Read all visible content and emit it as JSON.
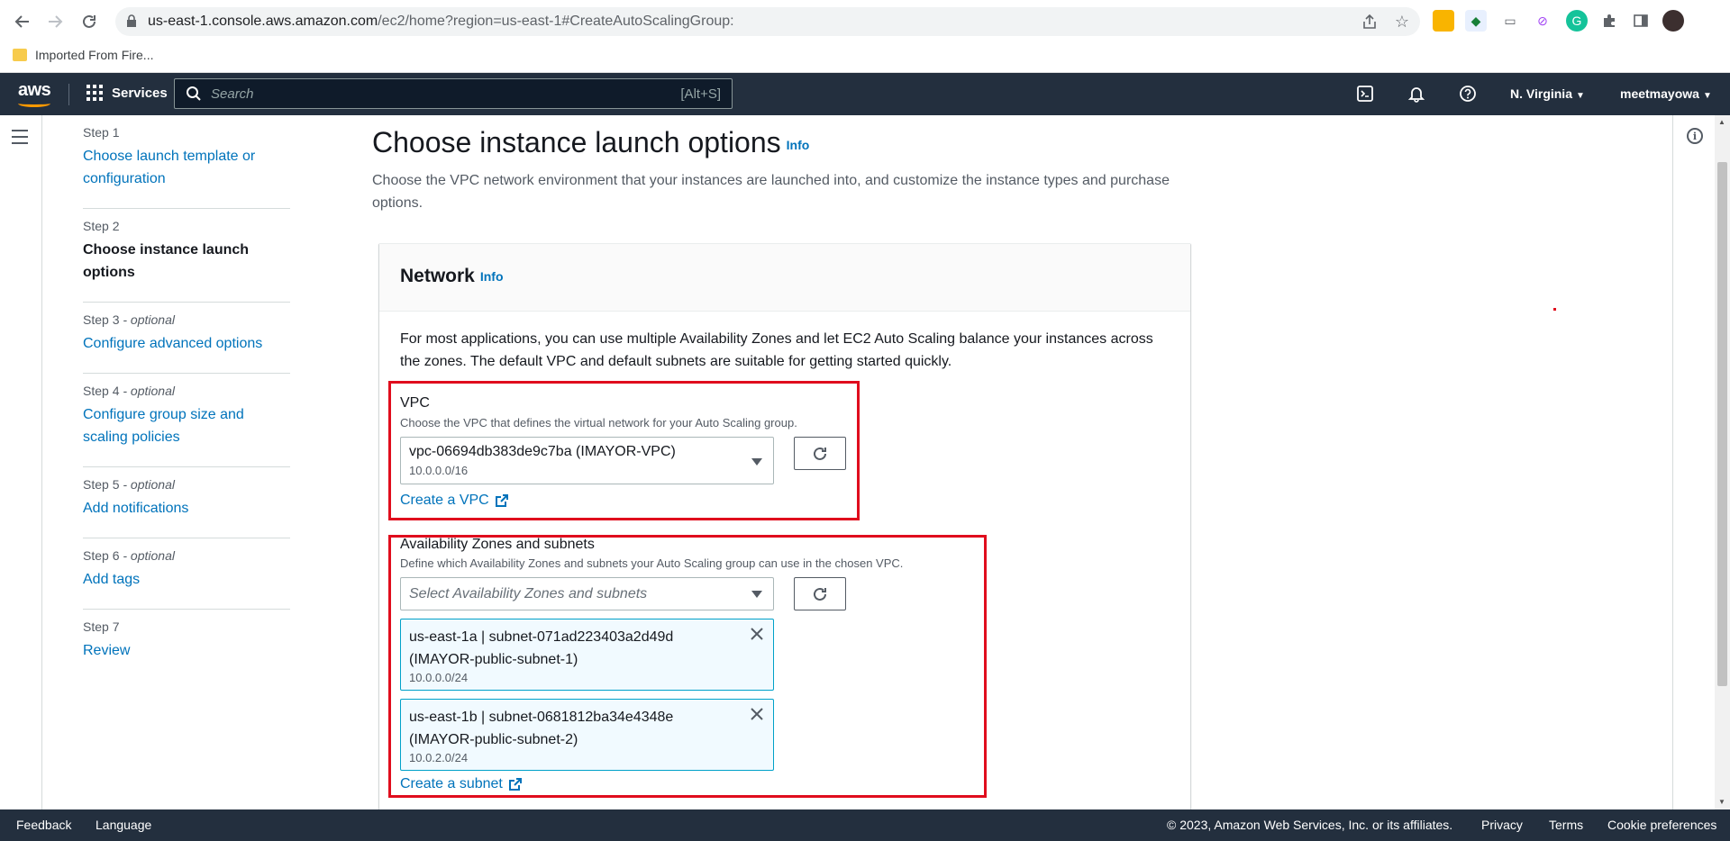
{
  "browser": {
    "url_host": "us-east-1.console.aws.amazon.com",
    "url_path": "/ec2/home?region=us-east-1#CreateAutoScalingGroup:",
    "bookmark_label": "Imported From Fire..."
  },
  "header": {
    "logo": "aws",
    "services_label": "Services",
    "search_placeholder": "Search",
    "search_shortcut": "[Alt+S]",
    "region": "N. Virginia",
    "user": "meetmayowa"
  },
  "steps": [
    {
      "num": "Step 1",
      "optional": "",
      "label": "Choose launch template or configuration",
      "current": false
    },
    {
      "num": "Step 2",
      "optional": "",
      "label": "Choose instance launch options",
      "current": true
    },
    {
      "num": "Step 3",
      "optional": " - optional",
      "label": "Configure advanced options",
      "current": false
    },
    {
      "num": "Step 4",
      "optional": " - optional",
      "label": "Configure group size and scaling policies",
      "current": false
    },
    {
      "num": "Step 5",
      "optional": " - optional",
      "label": "Add notifications",
      "current": false
    },
    {
      "num": "Step 6",
      "optional": " - optional",
      "label": "Add tags",
      "current": false
    },
    {
      "num": "Step 7",
      "optional": "",
      "label": "Review",
      "current": false
    }
  ],
  "page": {
    "title": "Choose instance launch options",
    "info": "Info",
    "description": "Choose the VPC network environment that your instances are launched into, and customize the instance types and purchase options."
  },
  "network": {
    "title": "Network",
    "info": "Info",
    "description": "For most applications, you can use multiple Availability Zones and let EC2 Auto Scaling balance your instances across the zones. The default VPC and default subnets are suitable for getting started quickly.",
    "vpc": {
      "label": "VPC",
      "hint": "Choose the VPC that defines the virtual network for your Auto Scaling group.",
      "value": "vpc-06694db383de9c7ba (IMAYOR-VPC)",
      "cidr": "10.0.0.0/16",
      "create_link": "Create a VPC"
    },
    "az": {
      "label": "Availability Zones and subnets",
      "hint": "Define which Availability Zones and subnets your Auto Scaling group can use in the chosen VPC.",
      "placeholder": "Select Availability Zones and subnets",
      "tokens": [
        {
          "title": "us-east-1a | subnet-071ad223403a2d49d (IMAYOR-public-subnet-1)",
          "cidr": "10.0.0.0/24"
        },
        {
          "title": "us-east-1b | subnet-0681812ba34e4348e (IMAYOR-public-subnet-2)",
          "cidr": "10.0.2.0/24"
        }
      ],
      "create_link": "Create a subnet"
    }
  },
  "footer": {
    "feedback": "Feedback",
    "language": "Language",
    "copyright": "© 2023, Amazon Web Services, Inc. or its affiliates.",
    "privacy": "Privacy",
    "terms": "Terms",
    "cookies": "Cookie preferences"
  },
  "colors": {
    "aws_header": "#232f3e",
    "link": "#0073bb",
    "highlight_box": "#e00d1d"
  }
}
